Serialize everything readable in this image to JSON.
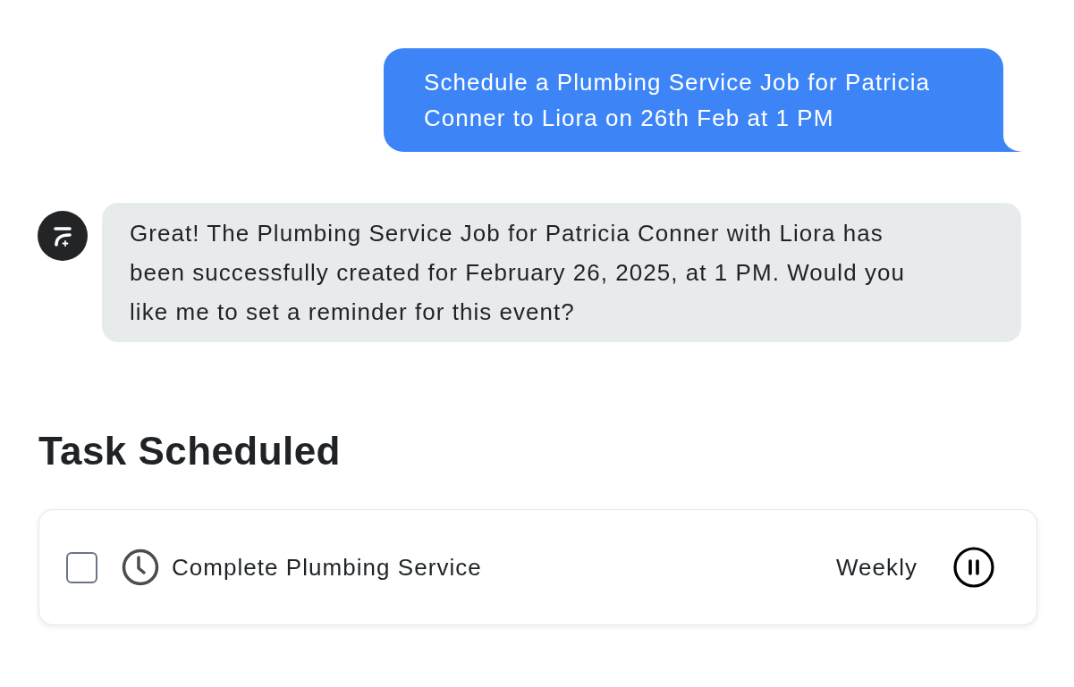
{
  "messages": [
    {
      "kind": "user",
      "text": "Schedule a Plumbing Service Job for Patricia Conner to Liora on 26th Feb at 1 PM"
    },
    {
      "kind": "assistant",
      "text": "Great! The Plumbing Service Job for Patricia Conner with Liora has been successfully created for February 26, 2025, at 1 PM. Would you like me to set a reminder for this event?"
    }
  ],
  "section_title": "Task Scheduled",
  "tasks": [
    {
      "checked": false,
      "title": "Complete Plumbing Service",
      "frequency": "Weekly"
    }
  ]
}
